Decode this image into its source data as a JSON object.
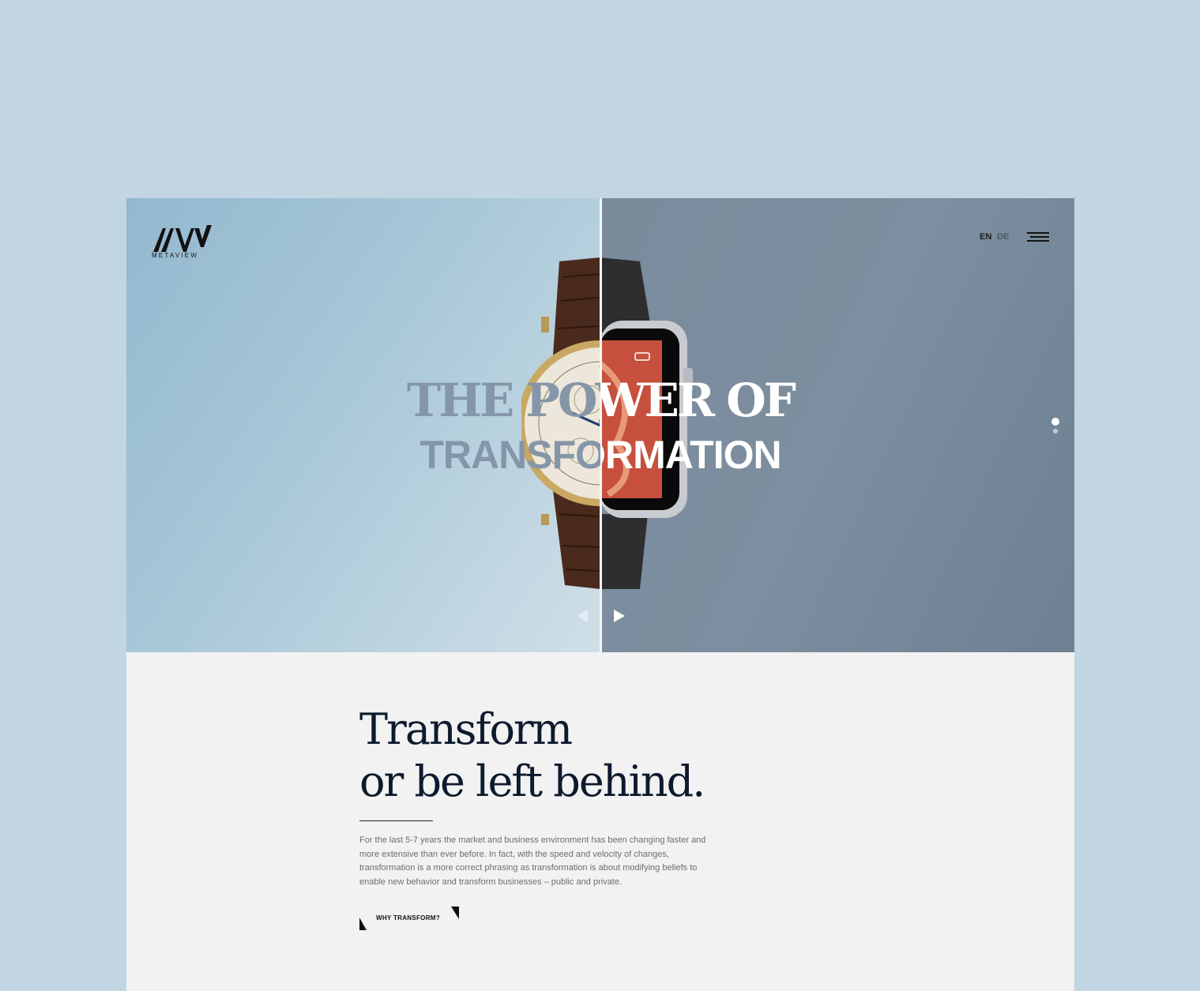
{
  "brand": {
    "logo_text": "METAVIEW"
  },
  "header": {
    "lang_en": "EN",
    "lang_de": "DE"
  },
  "hero": {
    "line1": "THE POWER OF",
    "line2": "TRANSFORMATION",
    "slides": {
      "count": 2,
      "active": 1
    }
  },
  "intro": {
    "heading_line1": "Transform",
    "heading_line2": "or be left behind.",
    "paragraph": "For the last 5-7 years the market and business environment has been changing faster and more extensive than ever before. In fact, with the speed and velocity of changes, transformation is a more correct phrasing as transformation is about modifying beliefs to enable new behavior and transform businesses – public and private.",
    "cta_label": "WHY TRANSFORM?"
  },
  "colors": {
    "page_bg": "#c2d5e2",
    "hero_left": "#a9c8d8",
    "hero_right": "#7a8c9c",
    "heading": "#0d1a2e",
    "content_bg": "#f2f2f2"
  },
  "icons": [
    "metaview-logo",
    "menu-icon",
    "classic-watch-icon",
    "smartwatch-icon",
    "prev-arrow-icon",
    "next-arrow-icon",
    "slide-dot-icon"
  ]
}
